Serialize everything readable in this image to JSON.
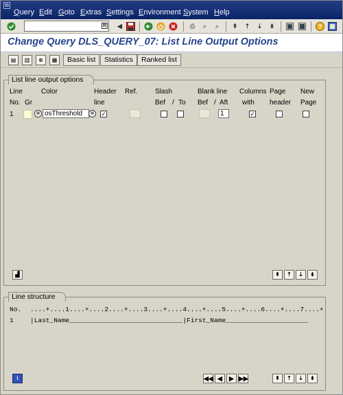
{
  "menu": {
    "items": [
      "Query",
      "Edit",
      "Goto",
      "Extras",
      "Settings",
      "Environment",
      "System",
      "Help"
    ]
  },
  "stdbar": {
    "command_value": ""
  },
  "title": "Change Query DLS_QUERY_07: List Line Output Options",
  "appbar": {
    "buttons": [
      "Basic list",
      "Statistics",
      "Ranked list"
    ]
  },
  "options": {
    "group_title": "List line output options",
    "headers": {
      "line": "Line",
      "no": "No.",
      "gr": "Gr",
      "color": "Color",
      "header": "Header",
      "header_line": "line",
      "ref": "Ref.",
      "slash": "Slash",
      "bef1": "Bef",
      "slash_sep": "/",
      "to": "To",
      "blank_line": "Blank line",
      "bef2": "Bef",
      "blank_sep": "/",
      "aft": "Aft",
      "columns": "Columns",
      "with": "with",
      "page": "Page",
      "page_header": "header",
      "new": "New",
      "new_page": "Page"
    },
    "row": {
      "no": "1",
      "color_value": "osThreshold",
      "header_line_checked": true,
      "slash_before": false,
      "slash_to": false,
      "blank_after": "1",
      "columns_with_checked": true,
      "page_header_checked": false,
      "new_page_checked": false
    }
  },
  "structure": {
    "group_title": "Line structure",
    "ruler_label": "No.",
    "ruler": "....+....1....+....2....+....3....+....4....+....5....+....6....+....7....+",
    "row_no": "1",
    "row_text": "|Last_Name_____________________________|First_Name_____________________"
  },
  "icons": {
    "enter": "check-icon",
    "save": "save-icon",
    "back": "back-icon",
    "exit": "exit-icon",
    "cancel": "cancel-icon",
    "print": "print-icon",
    "find": "find-icon",
    "help": "help-icon",
    "info": "info-icon"
  },
  "colors": {
    "menubar": "#0b2466",
    "title": "#27458e",
    "panel": "#d7d4c8",
    "swatch": "#fdfbd3",
    "ok_green": "#2e8b2e",
    "cancel_red": "#c8261e"
  }
}
